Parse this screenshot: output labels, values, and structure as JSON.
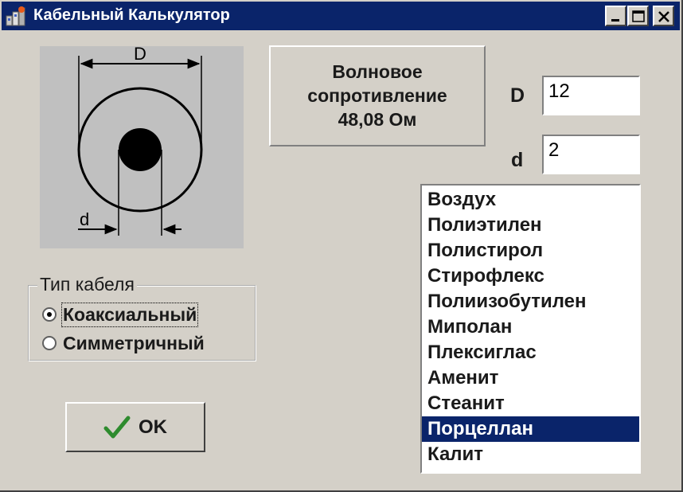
{
  "window": {
    "title": "Кабельный Калькулятор",
    "controls": [
      "minimize-icon",
      "maximize-icon",
      "close-icon"
    ]
  },
  "diagram": {
    "outer_label": "D",
    "inner_label": "d"
  },
  "result": {
    "line1": "Волновое",
    "line2": "сопротивление",
    "line3": "48,08 Ом"
  },
  "fields": {
    "D": {
      "label": "D",
      "value": "12"
    },
    "d": {
      "label": "d",
      "value": "2"
    }
  },
  "cable_type": {
    "legend": "Тип кабеля",
    "options": [
      {
        "label": "Коаксиальный",
        "checked": true
      },
      {
        "label": "Симметричный",
        "checked": false
      }
    ]
  },
  "ok_button": {
    "label": "OK",
    "icon": "checkmark-icon"
  },
  "dielectric_list": {
    "items": [
      "Воздух",
      "Полиэтилен",
      "Полистирол",
      "Стирофлекс",
      "Полиизобутилен",
      "Миполан",
      "Плексиглас",
      "Аменит",
      "Стеанит",
      "Порцеллан",
      "Калит"
    ],
    "selected": "Порцеллан"
  },
  "colors": {
    "titlebar": "#0a246a",
    "window_bg": "#d4d0c8",
    "selection": "#0a246a",
    "checkmark": "#2e8b2e"
  }
}
